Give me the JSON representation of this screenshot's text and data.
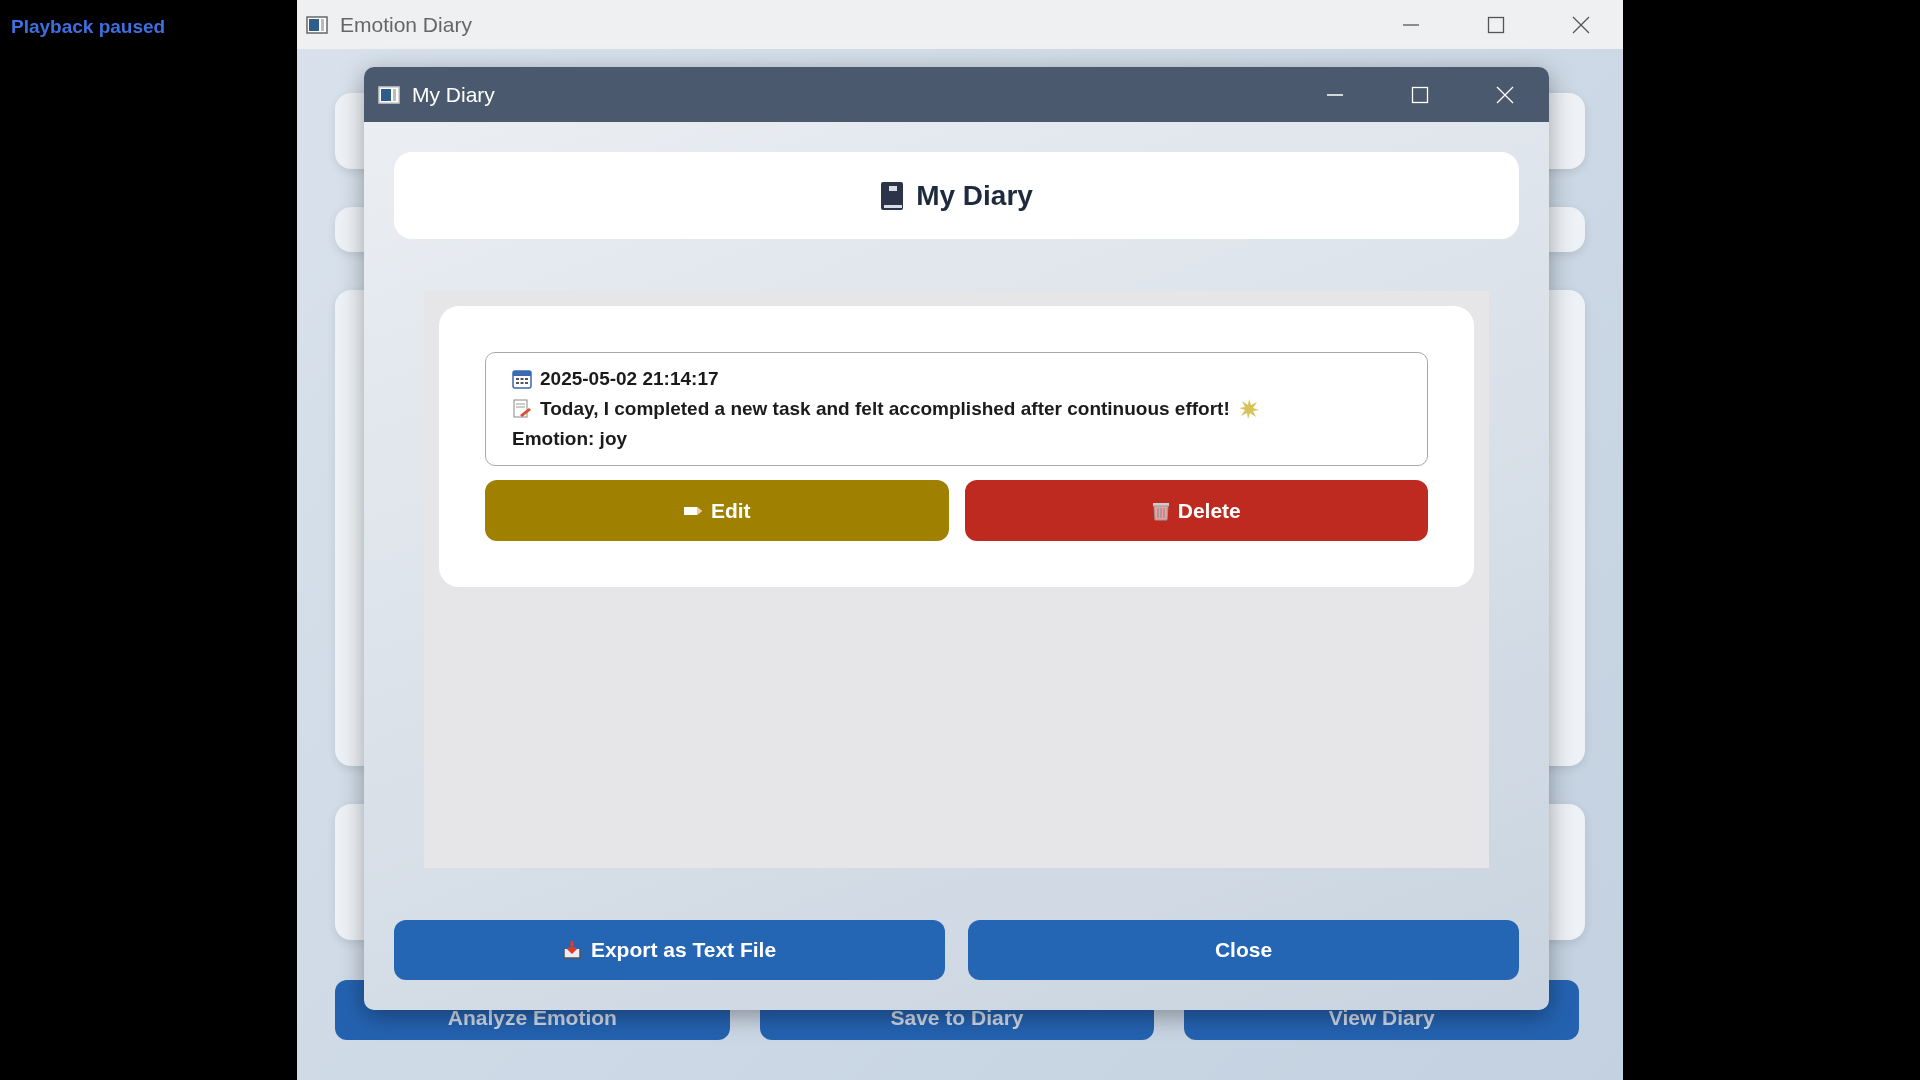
{
  "video_status": "Playback paused",
  "main_window": {
    "title": "Emotion Diary",
    "buttons": [
      {
        "label": "Analyze Emotion"
      },
      {
        "label": "Save to Diary"
      },
      {
        "label": "View Diary"
      }
    ]
  },
  "dialog": {
    "title": "My Diary",
    "heading": "My Diary",
    "entries": [
      {
        "date": "2025-05-02 21:14:17",
        "text": "Today, I completed a new task and felt accomplished after continuous effort!",
        "emotion": "Emotion: joy",
        "buttons": [
          {
            "kind": "edit",
            "label": "Edit"
          },
          {
            "kind": "delete",
            "label": "Delete"
          }
        ]
      }
    ],
    "footer_buttons": [
      {
        "kind": "export",
        "label": "Export as Text File"
      },
      {
        "kind": "close",
        "label": "Close"
      }
    ]
  }
}
